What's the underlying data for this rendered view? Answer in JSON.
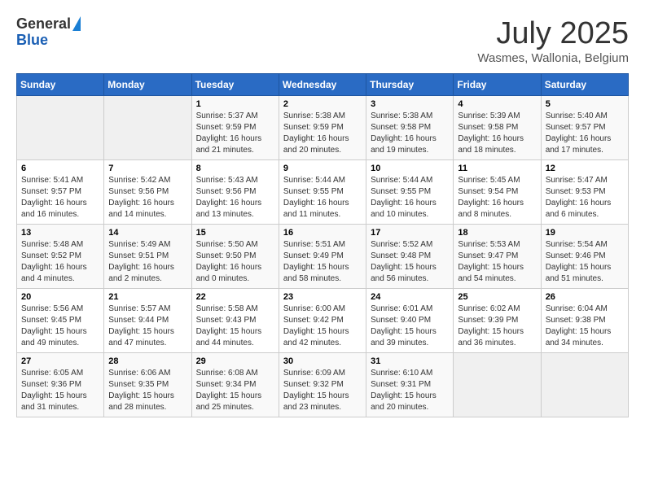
{
  "header": {
    "logo_general": "General",
    "logo_blue": "Blue",
    "month": "July 2025",
    "location": "Wasmes, Wallonia, Belgium"
  },
  "days_of_week": [
    "Sunday",
    "Monday",
    "Tuesday",
    "Wednesday",
    "Thursday",
    "Friday",
    "Saturday"
  ],
  "weeks": [
    [
      {
        "day": "",
        "info": ""
      },
      {
        "day": "",
        "info": ""
      },
      {
        "day": "1",
        "sunrise": "5:37 AM",
        "sunset": "9:59 PM",
        "daylight": "16 hours and 21 minutes."
      },
      {
        "day": "2",
        "sunrise": "5:38 AM",
        "sunset": "9:59 PM",
        "daylight": "16 hours and 20 minutes."
      },
      {
        "day": "3",
        "sunrise": "5:38 AM",
        "sunset": "9:58 PM",
        "daylight": "16 hours and 19 minutes."
      },
      {
        "day": "4",
        "sunrise": "5:39 AM",
        "sunset": "9:58 PM",
        "daylight": "16 hours and 18 minutes."
      },
      {
        "day": "5",
        "sunrise": "5:40 AM",
        "sunset": "9:57 PM",
        "daylight": "16 hours and 17 minutes."
      }
    ],
    [
      {
        "day": "6",
        "sunrise": "5:41 AM",
        "sunset": "9:57 PM",
        "daylight": "16 hours and 16 minutes."
      },
      {
        "day": "7",
        "sunrise": "5:42 AM",
        "sunset": "9:56 PM",
        "daylight": "16 hours and 14 minutes."
      },
      {
        "day": "8",
        "sunrise": "5:43 AM",
        "sunset": "9:56 PM",
        "daylight": "16 hours and 13 minutes."
      },
      {
        "day": "9",
        "sunrise": "5:44 AM",
        "sunset": "9:55 PM",
        "daylight": "16 hours and 11 minutes."
      },
      {
        "day": "10",
        "sunrise": "5:44 AM",
        "sunset": "9:55 PM",
        "daylight": "16 hours and 10 minutes."
      },
      {
        "day": "11",
        "sunrise": "5:45 AM",
        "sunset": "9:54 PM",
        "daylight": "16 hours and 8 minutes."
      },
      {
        "day": "12",
        "sunrise": "5:47 AM",
        "sunset": "9:53 PM",
        "daylight": "16 hours and 6 minutes."
      }
    ],
    [
      {
        "day": "13",
        "sunrise": "5:48 AM",
        "sunset": "9:52 PM",
        "daylight": "16 hours and 4 minutes."
      },
      {
        "day": "14",
        "sunrise": "5:49 AM",
        "sunset": "9:51 PM",
        "daylight": "16 hours and 2 minutes."
      },
      {
        "day": "15",
        "sunrise": "5:50 AM",
        "sunset": "9:50 PM",
        "daylight": "16 hours and 0 minutes."
      },
      {
        "day": "16",
        "sunrise": "5:51 AM",
        "sunset": "9:49 PM",
        "daylight": "15 hours and 58 minutes."
      },
      {
        "day": "17",
        "sunrise": "5:52 AM",
        "sunset": "9:48 PM",
        "daylight": "15 hours and 56 minutes."
      },
      {
        "day": "18",
        "sunrise": "5:53 AM",
        "sunset": "9:47 PM",
        "daylight": "15 hours and 54 minutes."
      },
      {
        "day": "19",
        "sunrise": "5:54 AM",
        "sunset": "9:46 PM",
        "daylight": "15 hours and 51 minutes."
      }
    ],
    [
      {
        "day": "20",
        "sunrise": "5:56 AM",
        "sunset": "9:45 PM",
        "daylight": "15 hours and 49 minutes."
      },
      {
        "day": "21",
        "sunrise": "5:57 AM",
        "sunset": "9:44 PM",
        "daylight": "15 hours and 47 minutes."
      },
      {
        "day": "22",
        "sunrise": "5:58 AM",
        "sunset": "9:43 PM",
        "daylight": "15 hours and 44 minutes."
      },
      {
        "day": "23",
        "sunrise": "6:00 AM",
        "sunset": "9:42 PM",
        "daylight": "15 hours and 42 minutes."
      },
      {
        "day": "24",
        "sunrise": "6:01 AM",
        "sunset": "9:40 PM",
        "daylight": "15 hours and 39 minutes."
      },
      {
        "day": "25",
        "sunrise": "6:02 AM",
        "sunset": "9:39 PM",
        "daylight": "15 hours and 36 minutes."
      },
      {
        "day": "26",
        "sunrise": "6:04 AM",
        "sunset": "9:38 PM",
        "daylight": "15 hours and 34 minutes."
      }
    ],
    [
      {
        "day": "27",
        "sunrise": "6:05 AM",
        "sunset": "9:36 PM",
        "daylight": "15 hours and 31 minutes."
      },
      {
        "day": "28",
        "sunrise": "6:06 AM",
        "sunset": "9:35 PM",
        "daylight": "15 hours and 28 minutes."
      },
      {
        "day": "29",
        "sunrise": "6:08 AM",
        "sunset": "9:34 PM",
        "daylight": "15 hours and 25 minutes."
      },
      {
        "day": "30",
        "sunrise": "6:09 AM",
        "sunset": "9:32 PM",
        "daylight": "15 hours and 23 minutes."
      },
      {
        "day": "31",
        "sunrise": "6:10 AM",
        "sunset": "9:31 PM",
        "daylight": "15 hours and 20 minutes."
      },
      {
        "day": "",
        "info": ""
      },
      {
        "day": "",
        "info": ""
      }
    ]
  ]
}
